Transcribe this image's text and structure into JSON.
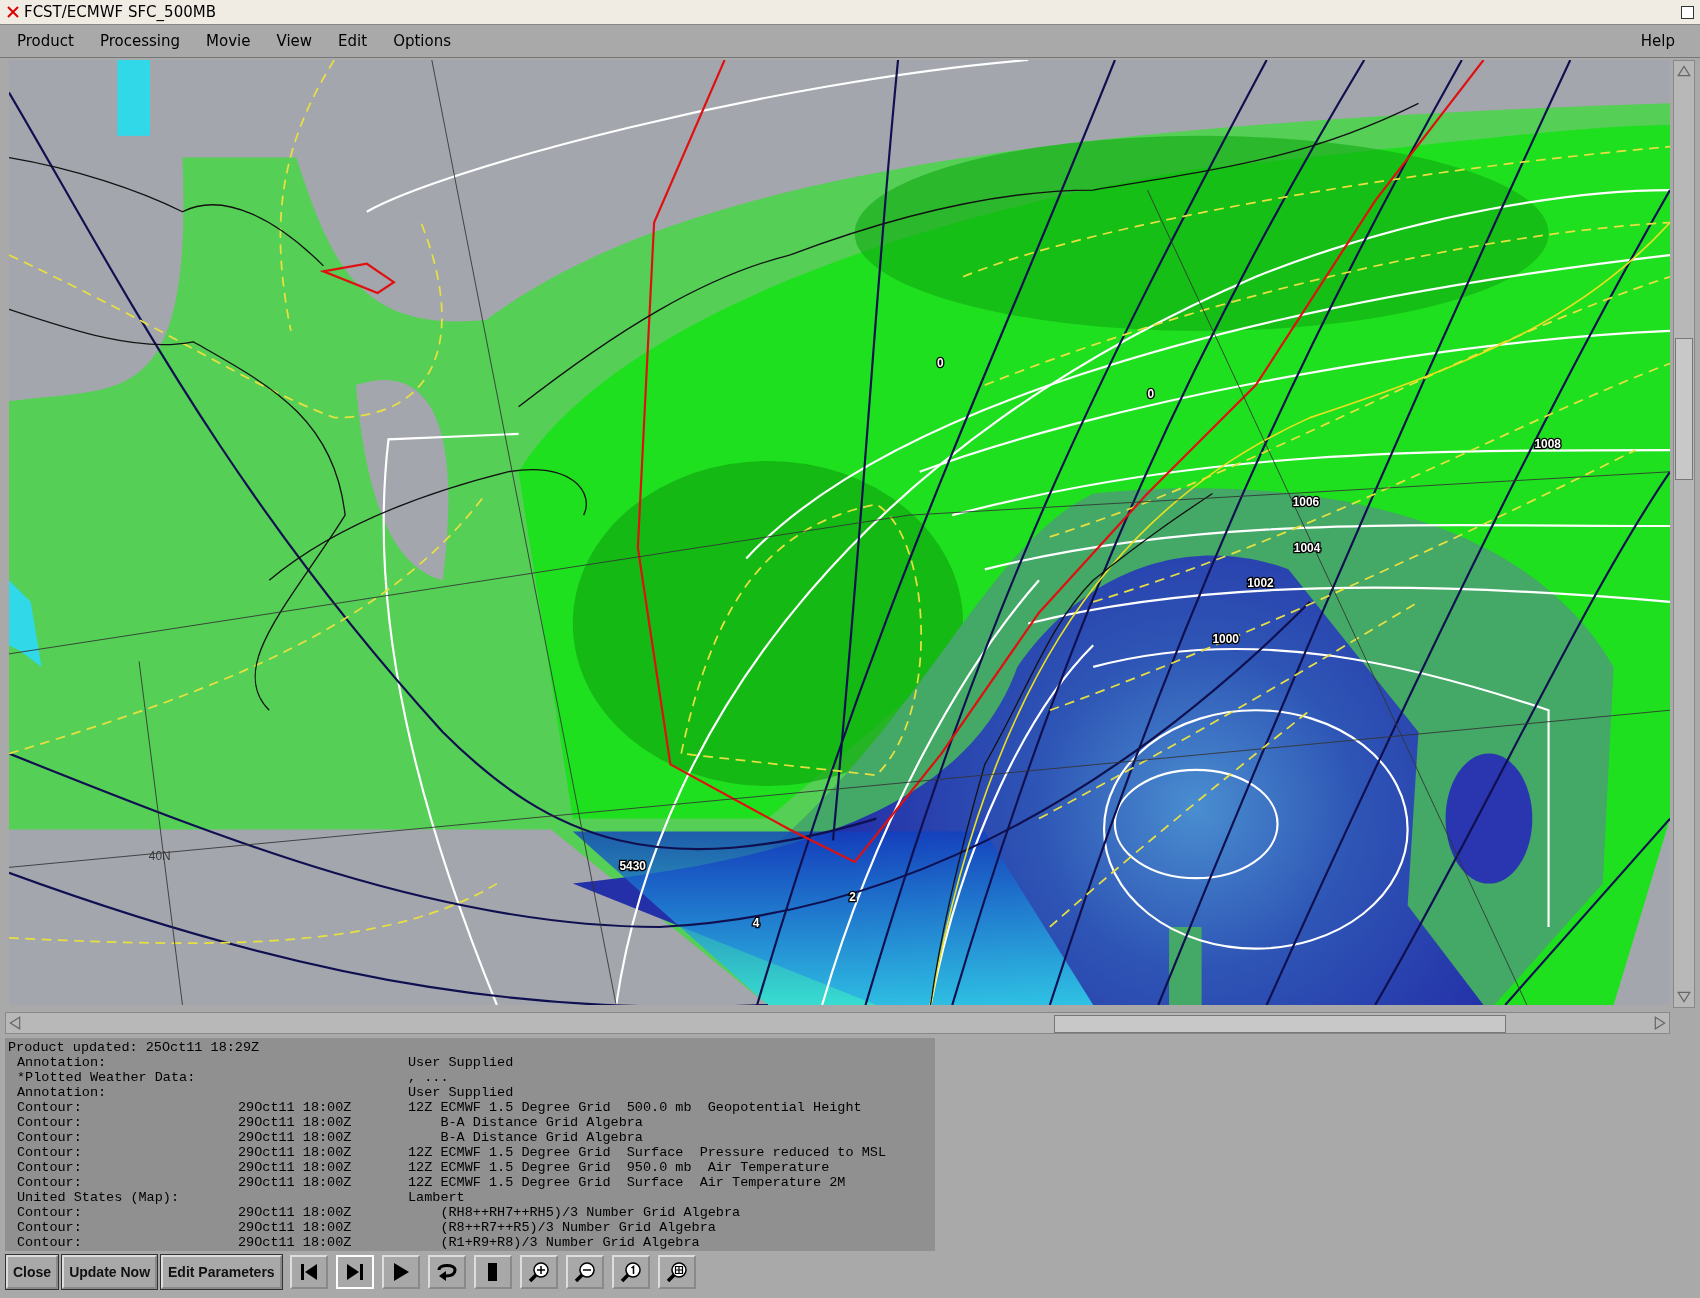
{
  "window": {
    "title": "FCST/ECMWF SFC_500MB"
  },
  "menu": {
    "items": [
      "Product",
      "Processing",
      "Movie",
      "View",
      "Edit",
      "Options"
    ],
    "help": "Help"
  },
  "map": {
    "labels": [
      "0",
      "0",
      "1008",
      "1006",
      "1004",
      "1002",
      "1000",
      "40N",
      "5430",
      "2",
      "4"
    ]
  },
  "info_panel": {
    "updated": "Product updated: 25Oct11 18:29Z",
    "rows": [
      {
        "label": "Annotation:",
        "time": "",
        "detail": "User Supplied"
      },
      {
        "label": "*Plotted Weather Data:",
        "time": "",
        "detail": ", ..."
      },
      {
        "label": "Annotation:",
        "time": "",
        "detail": "User Supplied"
      },
      {
        "label": "Contour:",
        "time": "29Oct11 18:00Z",
        "detail": "12Z ECMWF 1.5 Degree Grid  500.0 mb  Geopotential Height"
      },
      {
        "label": "Contour:",
        "time": "29Oct11 18:00Z",
        "detail": "    B-A Distance Grid Algebra"
      },
      {
        "label": "Contour:",
        "time": "29Oct11 18:00Z",
        "detail": "    B-A Distance Grid Algebra"
      },
      {
        "label": "Contour:",
        "time": "29Oct11 18:00Z",
        "detail": "12Z ECMWF 1.5 Degree Grid  Surface  Pressure reduced to MSL"
      },
      {
        "label": "Contour:",
        "time": "29Oct11 18:00Z",
        "detail": "12Z ECMWF 1.5 Degree Grid  950.0 mb  Air Temperature"
      },
      {
        "label": "Contour:",
        "time": "29Oct11 18:00Z",
        "detail": "12Z ECMWF 1.5 Degree Grid  Surface  Air Temperature 2M"
      },
      {
        "label": "United States (Map):",
        "time": "",
        "detail": "Lambert"
      },
      {
        "label": "Contour:",
        "time": "29Oct11 18:00Z",
        "detail": "    (RH8++RH7++RH5)/3 Number Grid Algebra"
      },
      {
        "label": "Contour:",
        "time": "29Oct11 18:00Z",
        "detail": "    (R8++R7++R5)/3 Number Grid Algebra"
      },
      {
        "label": "Contour:",
        "time": "29Oct11 18:00Z",
        "detail": "    (R1+R9+R8)/3 Number Grid Algebra"
      }
    ]
  },
  "toolbar": {
    "buttons": [
      "Close",
      "Update Now",
      "Edit Parameters"
    ],
    "tools": [
      {
        "kind": "first",
        "selected": false
      },
      {
        "kind": "last",
        "selected": true
      },
      {
        "kind": "play",
        "selected": false
      },
      {
        "kind": "loop",
        "selected": false
      },
      {
        "kind": "stop",
        "selected": false
      },
      {
        "kind": "zoom-in",
        "selected": false
      },
      {
        "kind": "zoom-out",
        "selected": false
      },
      {
        "kind": "zoom-one",
        "selected": false
      },
      {
        "kind": "zoom-grid",
        "selected": false
      }
    ]
  }
}
